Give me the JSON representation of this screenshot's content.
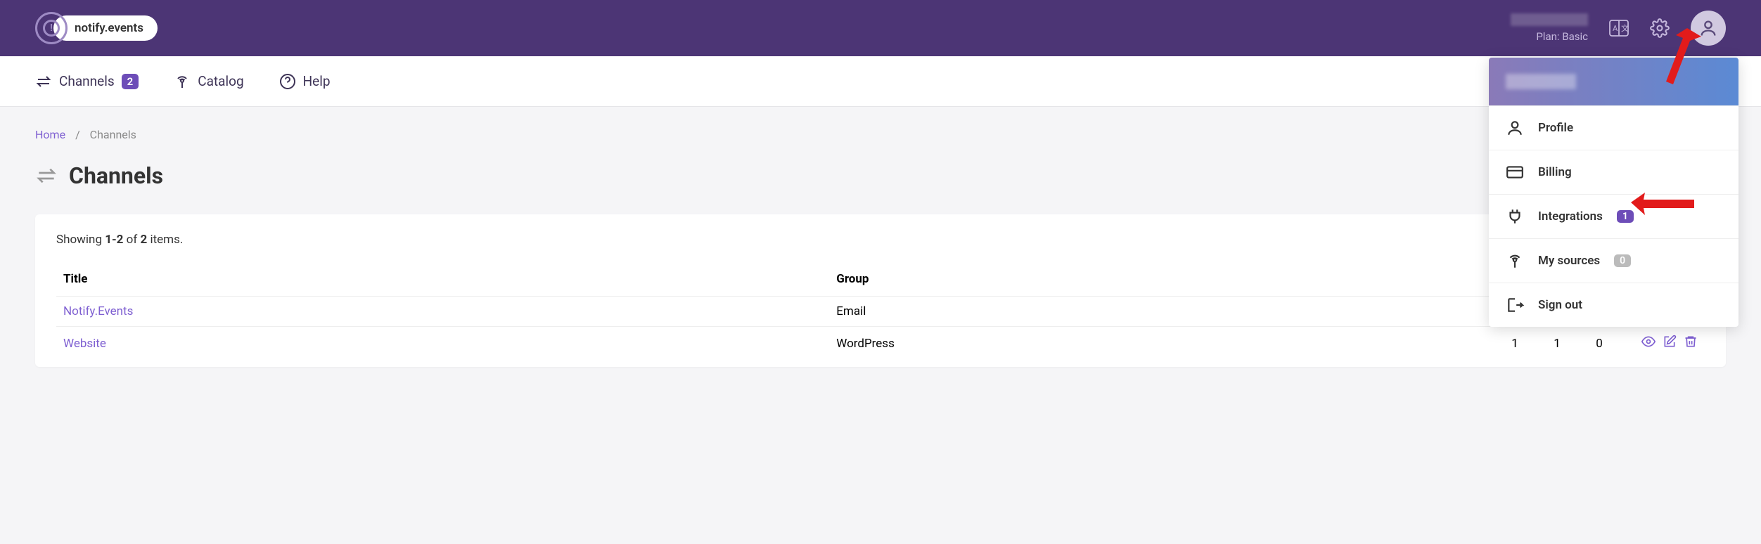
{
  "header": {
    "logo_text": "notify.events",
    "plan_label": "Plan: Basic"
  },
  "nav": {
    "channels": {
      "label": "Channels",
      "badge": "2"
    },
    "catalog": {
      "label": "Catalog"
    },
    "help": {
      "label": "Help"
    }
  },
  "breadcrumb": {
    "home": "Home",
    "current": "Channels"
  },
  "page": {
    "title": "Channels",
    "summary_prefix": "Showing ",
    "summary_range": "1-2",
    "summary_mid": " of ",
    "summary_total": "2",
    "summary_suffix": " items."
  },
  "table": {
    "headers": {
      "title": "Title",
      "group": "Group"
    },
    "rows": [
      {
        "title": "Notify.Events",
        "group": "Email",
        "c1": "",
        "c2": "",
        "c3": ""
      },
      {
        "title": "Website",
        "group": "WordPress",
        "c1": "1",
        "c2": "1",
        "c3": "0"
      }
    ]
  },
  "dropdown": {
    "profile": "Profile",
    "billing": "Billing",
    "integrations": "Integrations",
    "integrations_badge": "1",
    "my_sources": "My sources",
    "my_sources_badge": "0",
    "sign_out": "Sign out"
  }
}
